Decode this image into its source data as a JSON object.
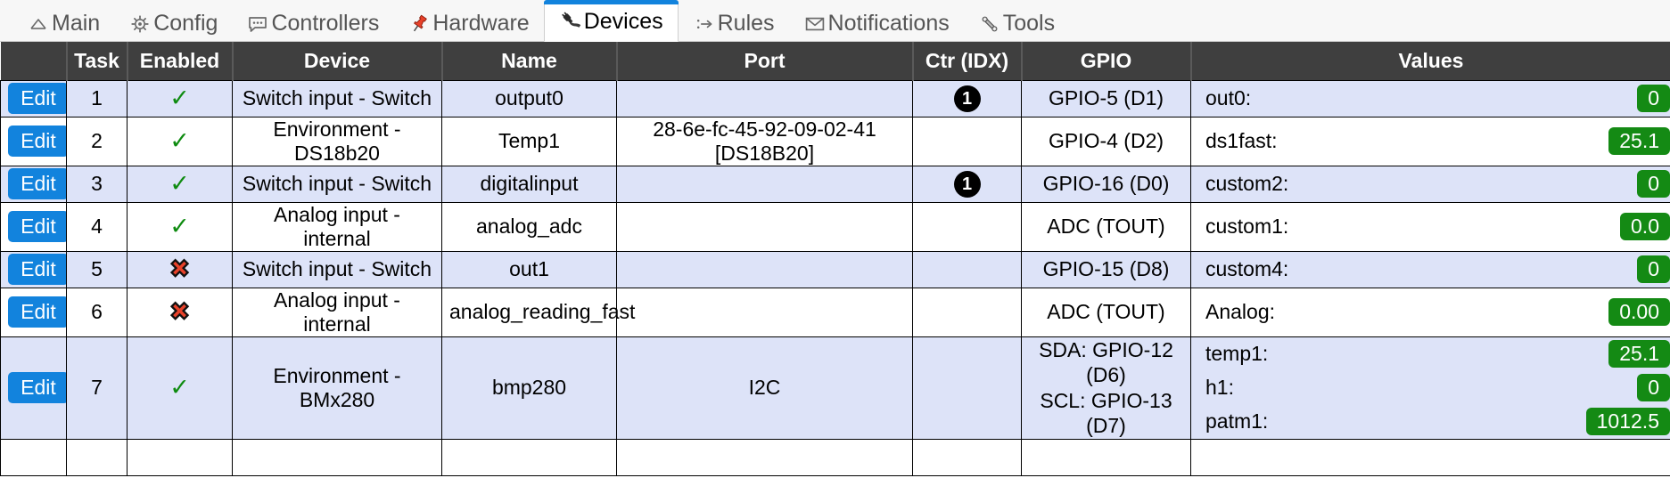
{
  "nav": {
    "tabs": [
      {
        "label": "Main",
        "icon": "home-icon",
        "active": false
      },
      {
        "label": "Config",
        "icon": "gear-icon",
        "active": false
      },
      {
        "label": "Controllers",
        "icon": "speech-bubble-icon",
        "active": false
      },
      {
        "label": "Hardware",
        "icon": "pushpin-icon",
        "active": false
      },
      {
        "label": "Devices",
        "icon": "plug-icon",
        "active": true
      },
      {
        "label": "Rules",
        "icon": "branch-arrow-icon",
        "active": false
      },
      {
        "label": "Notifications",
        "icon": "envelope-icon",
        "active": false
      },
      {
        "label": "Tools",
        "icon": "wrench-icon",
        "active": false
      }
    ]
  },
  "table": {
    "columns": [
      "",
      "Task",
      "Enabled",
      "Device",
      "Name",
      "Port",
      "Ctr (IDX)",
      "GPIO",
      "Values"
    ],
    "edit_label": "Edit",
    "enabled_yes_glyph": "✓",
    "enabled_no_glyph": "✖",
    "rows": [
      {
        "task": "1",
        "enabled": true,
        "device": "Switch input - Switch",
        "name": "output0",
        "port": "",
        "ctr": "1",
        "gpio": "GPIO-5 (D1)",
        "values": [
          {
            "label": "out0:",
            "value": "0"
          }
        ]
      },
      {
        "task": "2",
        "enabled": true,
        "device": "Environment - DS18b20",
        "name": "Temp1",
        "port": "28-6e-fc-45-92-09-02-41 [DS18B20]",
        "ctr": "",
        "gpio": "GPIO-4 (D2)",
        "values": [
          {
            "label": "ds1fast:",
            "value": "25.1"
          }
        ]
      },
      {
        "task": "3",
        "enabled": true,
        "device": "Switch input - Switch",
        "name": "digitalinput",
        "port": "",
        "ctr": "1",
        "gpio": "GPIO-16 (D0)",
        "values": [
          {
            "label": "custom2:",
            "value": "0"
          }
        ]
      },
      {
        "task": "4",
        "enabled": true,
        "device": "Analog input - internal",
        "name": "analog_adc",
        "port": "",
        "ctr": "",
        "gpio": "ADC (TOUT)",
        "values": [
          {
            "label": "custom1:",
            "value": "0.0"
          }
        ]
      },
      {
        "task": "5",
        "enabled": false,
        "device": "Switch input - Switch",
        "name": "out1",
        "port": "",
        "ctr": "",
        "gpio": "GPIO-15 (D8)",
        "values": [
          {
            "label": "custom4:",
            "value": "0"
          }
        ]
      },
      {
        "task": "6",
        "enabled": false,
        "device": "Analog input - internal",
        "name": "analog_reading_fast",
        "port": "",
        "ctr": "",
        "gpio": "ADC (TOUT)",
        "values": [
          {
            "label": "Analog:",
            "value": "0.00"
          }
        ]
      },
      {
        "task": "7",
        "enabled": true,
        "device": "Environment - BMx280",
        "name": "bmp280",
        "port": "I2C",
        "ctr": "",
        "gpio": "SDA: GPIO-12 (D6)\nSCL: GPIO-13 (D7)",
        "values": [
          {
            "label": "temp1:",
            "value": "25.1"
          },
          {
            "label": "h1:",
            "value": "0"
          },
          {
            "label": "patm1:",
            "value": "1012.5"
          }
        ]
      }
    ]
  },
  "colors": {
    "accent_blue": "#1283dd",
    "header_bg": "#3f3f3f",
    "row_alt_bg": "#dde3f8",
    "badge_green": "#148a14",
    "tick_green": "#0e8b10",
    "cross_red": "#e8422a",
    "active_tab_top": "#1283dd"
  }
}
